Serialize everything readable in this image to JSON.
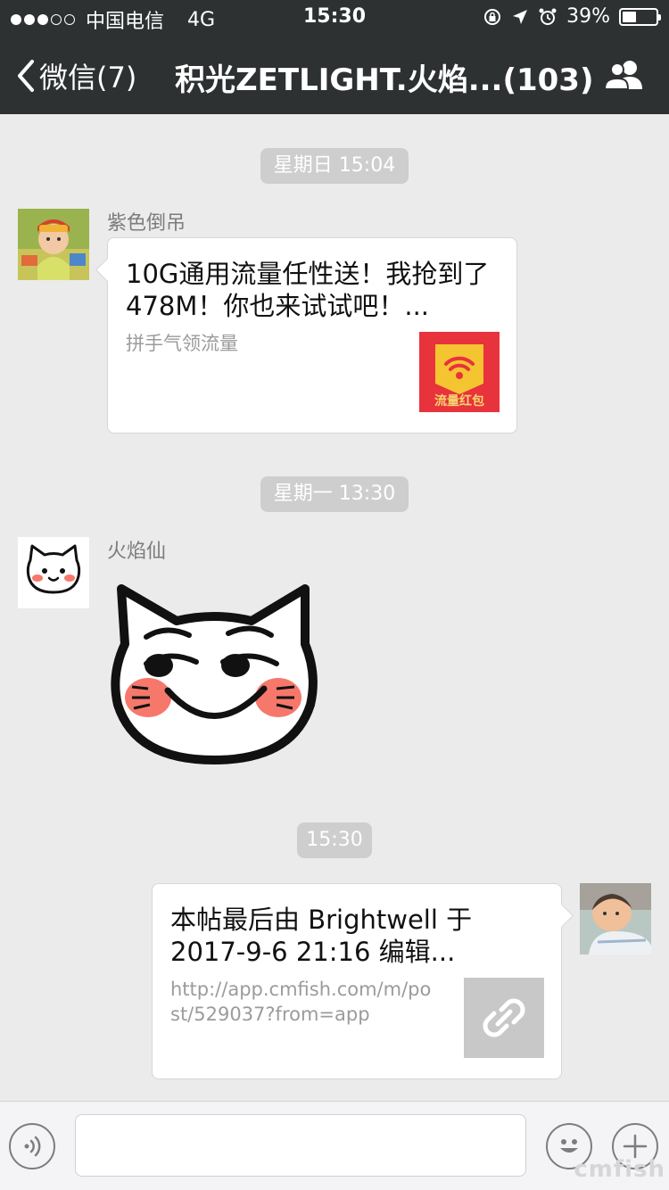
{
  "status": {
    "carrier": "中国电信",
    "network": "4G",
    "time": "15:30",
    "battery": "39%"
  },
  "nav": {
    "back_label": "微信(7)",
    "title": "积光ZETLIGHT.火焰...(103)"
  },
  "messages": [
    {
      "time": "星期日 15:04"
    },
    {
      "sender": "紫色倒吊",
      "card_title": "10G通用流量任性送！我抢到了478M！你也来试试吧！...",
      "card_desc": "拼手气领流量",
      "thumb_label": "流量红包"
    },
    {
      "time": "星期一 13:30"
    },
    {
      "sender": "火焰仙",
      "sticker": "cat-sticker"
    },
    {
      "time": "15:30"
    },
    {
      "card_title": "本帖最后由 Brightwell 于 2017-9-6 21:16 编辑...",
      "card_desc": "http://app.cmfish.com/m/post/529037?from=app"
    }
  ],
  "watermark": "cmfish",
  "colors": {
    "navbar": "#2e3132",
    "chat_bg": "#ebebeb",
    "red_packet": "#e8323c",
    "gold": "#f5c431"
  }
}
